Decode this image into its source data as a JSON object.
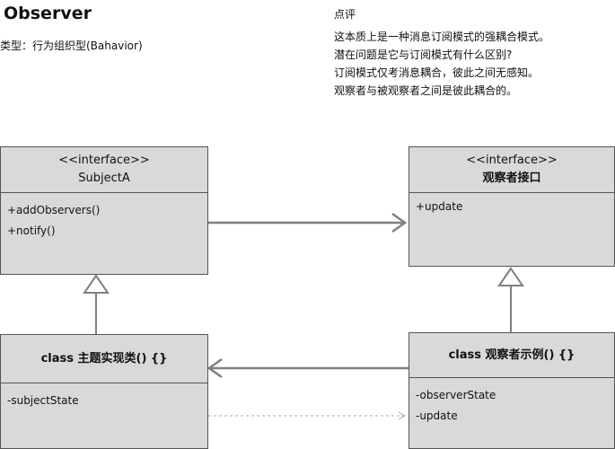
{
  "page": {
    "title": "Observer",
    "category": "类型：行为组织型(Bahavior)"
  },
  "commentary": {
    "title": "点评",
    "lines": [
      "这本质上是一种消息订阅模式的强耦合模式。",
      "潜在问题是它与订阅模式有什么区别?",
      "订阅模式仅考消息耦合，彼此之间无感知。",
      "观察者与被观察者之间是彼此耦合的。"
    ]
  },
  "nodes": {
    "subject_interface": {
      "stereotype": "<<interface>>",
      "name": "SubjectA",
      "members": [
        "+addObservers()",
        "+notify()"
      ]
    },
    "observer_interface": {
      "stereotype": "<<interface>>",
      "name": "观察者接口",
      "members": [
        "+update"
      ]
    },
    "concrete_subject": {
      "name": "class 主题实现类() {}",
      "members": [
        "-subjectState"
      ]
    },
    "concrete_observer": {
      "name": "class 观察者示例() {}",
      "members": [
        "-observerState",
        "-update"
      ]
    }
  },
  "colors": {
    "box_fill": "#d9d9d9",
    "box_border": "#555555",
    "arrow": "#7f7f7f",
    "dashed_arrow": "#aaaaaa"
  }
}
